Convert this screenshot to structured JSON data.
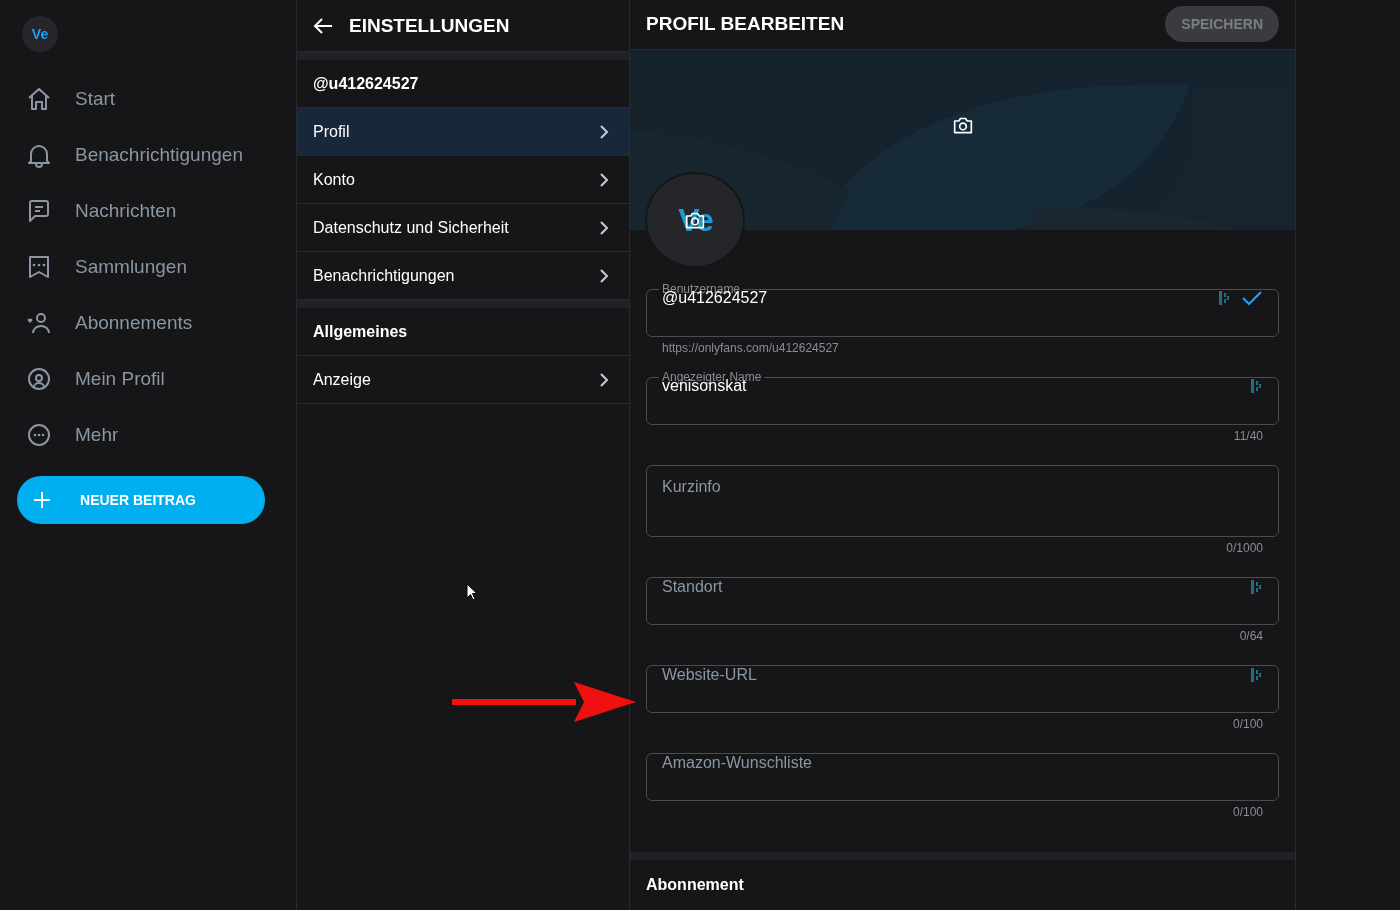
{
  "sidebar": {
    "avatar": "Ve",
    "items": [
      {
        "label": "Start",
        "selected": false
      },
      {
        "label": "Benachrichtigungen",
        "selected": false
      },
      {
        "label": "Nachrichten",
        "selected": false
      },
      {
        "label": "Sammlungen",
        "selected": false
      },
      {
        "label": "Abonnements",
        "selected": false
      },
      {
        "label": "Mein Profil",
        "selected": false
      },
      {
        "label": "Mehr",
        "selected": false
      }
    ],
    "new_post_button": "NEUER BEITRAG"
  },
  "settings": {
    "title": "EINSTELLUNGEN",
    "sections": [
      {
        "heading": "@u412624527",
        "items": [
          {
            "label": "Profil",
            "selected": true
          },
          {
            "label": "Konto",
            "selected": false
          },
          {
            "label": "Datenschutz und Sicherheit",
            "selected": false
          },
          {
            "label": "Benachrichtigungen",
            "selected": false
          }
        ]
      },
      {
        "heading": "Allgemeines",
        "items": [
          {
            "label": "Anzeige",
            "selected": false
          }
        ]
      }
    ]
  },
  "profile": {
    "title": "PROFIL BEARBEITEN",
    "save_button": {
      "label": "SPEICHERN",
      "disabled": true
    },
    "avatar": "Ve",
    "fields": [
      {
        "kind": "text",
        "label": "Benutzername",
        "value": "@u412624527",
        "helper": "https://onlyfans.com/u412624527",
        "assist": true,
        "verified": true
      },
      {
        "kind": "text",
        "label": "Angezeigter Name",
        "value": "venisonskat",
        "counter": "11/40",
        "assist": true,
        "verified": false
      },
      {
        "kind": "textarea",
        "placeholder": "Kurzinfo",
        "counter": "0/1000",
        "assist": false,
        "verified": false
      },
      {
        "kind": "text",
        "placeholder": "Standort",
        "counter": "0/64",
        "assist": true,
        "verified": false
      },
      {
        "kind": "text",
        "placeholder": "Website-URL",
        "counter": "0/100",
        "assist": true,
        "verified": false
      },
      {
        "kind": "text",
        "placeholder": "Amazon-Wunschliste",
        "counter": "0/100",
        "assist": false,
        "verified": false
      }
    ],
    "section_heading": "Abonnement"
  }
}
